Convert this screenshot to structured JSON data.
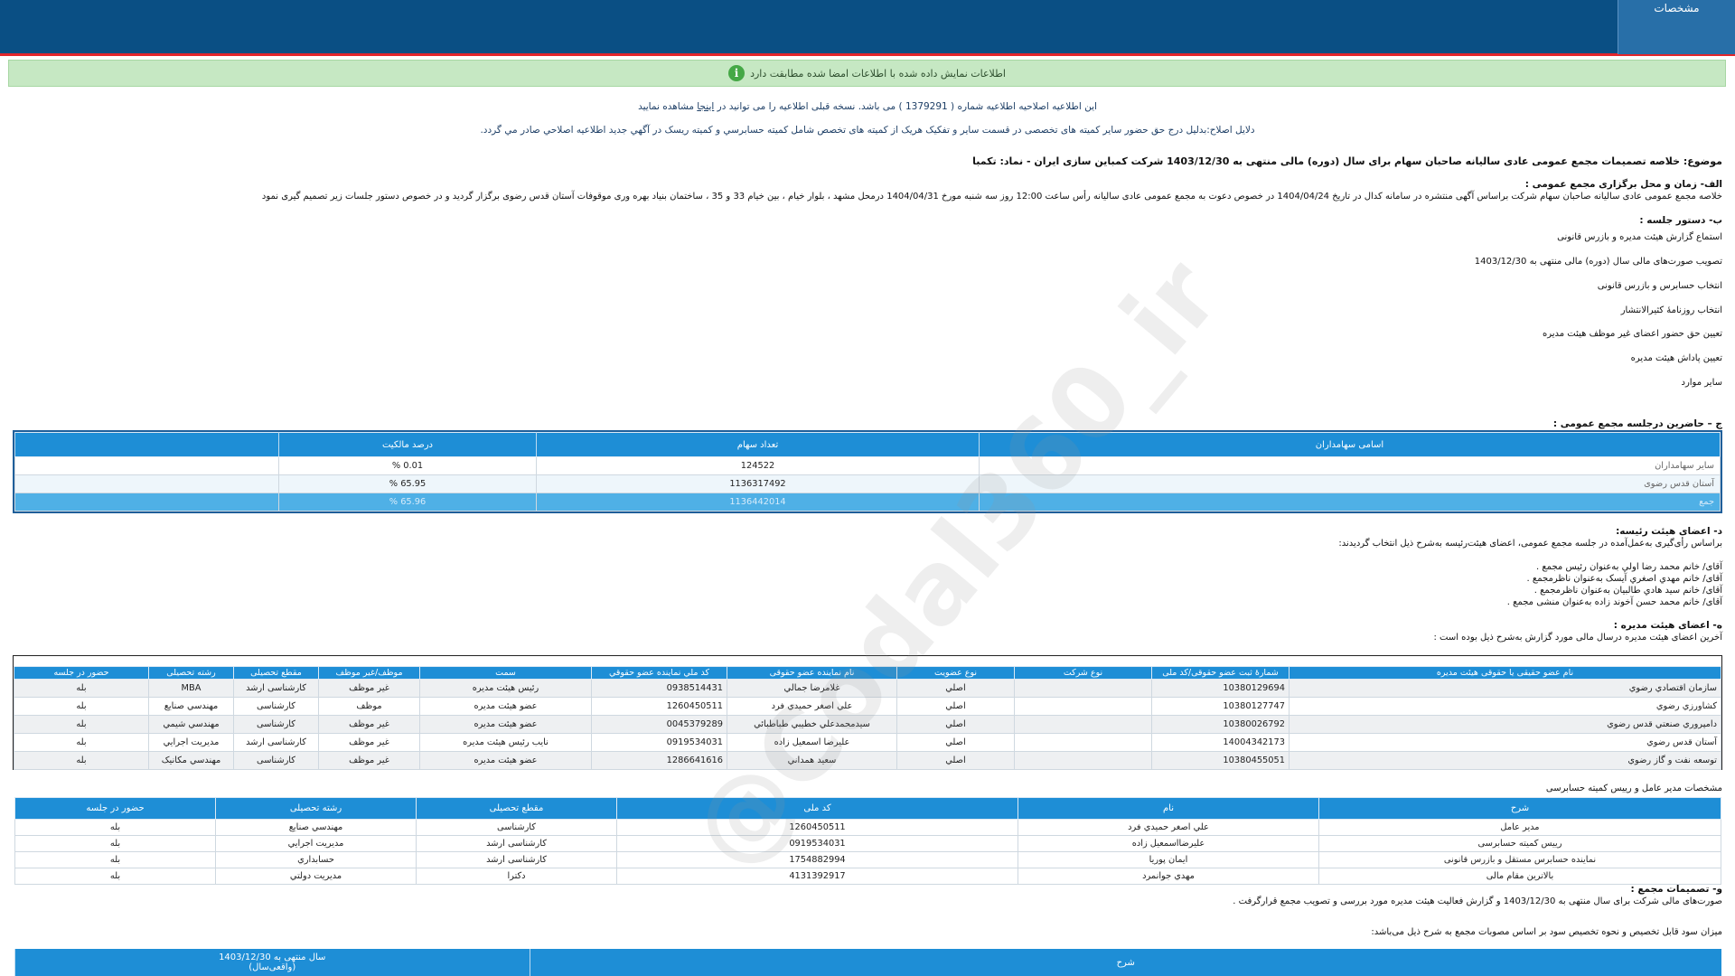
{
  "header": {
    "tab_label": "مشخصات"
  },
  "info_bar": {
    "text": "اطلاعات نمایش داده شده با اطلاعات امضا شده مطابقت دارد",
    "icon": "info-icon"
  },
  "correction_notice": {
    "line1_prefix": "این اطلاعیه اصلاحیه اطلاعیه شماره ( 1379291 ) می باشد. نسخه قبلی اطلاعیه را می توانید در",
    "link": "اینجا",
    "line1_suffix": "مشاهده نمایید",
    "reason": "دلایل اصلاح:بدلیل درج حق حضور سایر کمیته های تخصصی در قسمت سایر و تفکیک هریک از کمیته های تخصص شامل کمیته حسابرسي و کمیته ریسک در آگهي جدید اطلاعیه اصلاحي صادر مي گردد."
  },
  "subject": "موضوع: خلاصه تصمیمات مجمع عمومی عادی سالیانه صاحبان سهام برای سال (دوره) مالی منتهی به 1403/12/30 شرکت کمباین سازی ایران - نماد: تکمبا",
  "section_a": {
    "title": "الف- زمان و محل برگزاری مجمع عمومی :",
    "text": "خلاصه مجمع عمومی عادی سالیانه صاحبان سهام شرکت براساس آگهی منتشره در سامانه کدال در تاریخ 1404/04/24 در خصوص دعوت به مجمع عمومی عادی سالیانه رأس ساعت 12:00 روز سه شنبه مورخ 1404/04/31 درمحل  مشهد ، بلوار خیام ، بین خیام 33 و 35 ، ساختمان بنیاد بهره وری موقوفات آستان قدس رضوی   برگزار گردید و در خصوص دستور جلسات زیر تصمیم گیری نمود"
  },
  "section_b": {
    "title": "ب- دستور جلسه :",
    "items": [
      "استماع گزارش هیئت مدیره و بازرس قانونی",
      "تصویب صورت‌های مالی سال (دوره) مالی منتهی به 1403/12/30",
      "انتخاب حسابرس و بازرس قانونی",
      "انتخاب روزنامۀ کثیرالانتشار",
      "تعیین حق حضور اعضای غیر موظف هیئت مدیره",
      "تعیین پاداش هیئت مدیره",
      "سایر موارد"
    ]
  },
  "section_c": {
    "title": "ج – حاضرین درجلسه مجمع عمومی :",
    "headers": [
      "اسامی سهامداران",
      "تعداد سهام",
      "درصد مالکیت"
    ],
    "rows": [
      {
        "name": "سایر سهامداران",
        "shares": "124522",
        "percent": "0.01 %"
      },
      {
        "name": "آستان قدس رضوی",
        "shares": "1136317492",
        "percent": "65.95 %"
      }
    ],
    "total": {
      "name": "جمع",
      "shares": "1136442014",
      "percent": "65.96 %"
    }
  },
  "section_d": {
    "title": "د- اعضای هیئت رئیسه:",
    "intro": "براساس رأی‌گیری به‌عمل‌آمده در جلسه مجمع عمومی، اعضای هیئت‌رئیسه به‌شرح ذیل انتخاب گردیدند:",
    "members": [
      "آقای/ خانم  محمد رضا اولي  به‌عنوان رئیس مجمع .",
      "آقای/ خانم  مهدي اصغري آيسک  به‌عنوان ناظرمجمع .",
      "آقای/ خانم  سید هادي طالبيان  به‌عنوان ناظرمجمع .",
      "آقای/ خانم  محمد حسن آخوند زاده  به‌عنوان منشی مجمع ."
    ]
  },
  "section_e": {
    "title": "ه- اعضای هیئت مدیره :",
    "intro": "آخرین اعضای هیئت مدیره درسال مالی مورد گزارش به‌شرح ذیل بوده است :",
    "headers": [
      "نام عضو حقیقی یا حقوقی هیئت مدیره",
      "شمارۀ ثبت عضو حقوقی/کد ملی",
      "نوع شرکت",
      "نوع عضویت",
      "نام نماینده عضو حقوقی",
      "کد ملي نماینده عضو حقوقي",
      "سمت",
      "موظف/غیر موظف",
      "مقطع تحصیلی",
      "رشته تحصیلی",
      "حضور در جلسه"
    ],
    "rows": [
      [
        "سازمان اقتصادي رضوي",
        "10380129694",
        "",
        "اصلي",
        "غلامرضا جمالي",
        "0938514431",
        "رئیس هیئت مدیره",
        "غیر موظف",
        "کارشناسی ارشد",
        "MBA",
        "بله"
      ],
      [
        "کشاورزي رضوي",
        "10380127747",
        "",
        "اصلي",
        "علي اصغر حمیدي فرد",
        "1260450511",
        "عضو هیئت مدیره",
        "موظف",
        "کارشناسی",
        "مهندسي صنایع",
        "بله"
      ],
      [
        "دامپروري صنعتي قدس رضوي",
        "10380026792",
        "",
        "اصلي",
        "سیدمحمدعلي خطیبي طباطبائي",
        "0045379289",
        "عضو هیئت مدیره",
        "غیر موظف",
        "کارشناسی",
        "مهندسي شیمي",
        "بله"
      ],
      [
        "آستان قدس رضوي",
        "14004342173",
        "",
        "اصلي",
        "علیرضا اسمعیل زاده",
        "0919534031",
        "نایب رئیس هیئت مدیره",
        "غیر موظف",
        "کارشناسی ارشد",
        "مدیریت اجرایي",
        "بله"
      ],
      [
        "توسعه نفت و گاز رضوي",
        "10380455051",
        "",
        "اصلي",
        "سعید همداني",
        "1286641616",
        "عضو هیئت مدیره",
        "غیر موظف",
        "کارشناسی",
        "مهندسي مکانیک",
        "بله"
      ]
    ]
  },
  "ceo_section": {
    "title": "مشخصات مدیر عامل و رییس کمیته حسابرسی",
    "headers": [
      "شرح",
      "نام",
      "کد ملی",
      "مقطع تحصیلی",
      "رشته تحصیلی",
      "حضور در جلسه"
    ],
    "rows": [
      [
        "مدير عامل",
        "علي اصغر حمیدي فرد",
        "1260450511",
        "کارشناسی",
        "مهندسي صنایع",
        "بله"
      ],
      [
        "رییس کمیته حسابرسی",
        "علیرضااسمعیل زاده",
        "0919534031",
        "کارشناسی ارشد",
        "مدیریت اجرایي",
        "بله"
      ],
      [
        "نماینده حسابرس مستقل و بازرس قانونی",
        "ایمان پوریا",
        "1754882994",
        "کارشناسی ارشد",
        "حسابداري",
        "بله"
      ],
      [
        "بالاترین مقام مالی",
        "مهدي جوانمرد",
        "4131392917",
        "دکترا",
        "مدیریت دولتي",
        "بله"
      ]
    ]
  },
  "section_f": {
    "title": "و- تصمیمات مجمع :",
    "text": "صورت‌های مالی شرکت برای سال منتهی به  1403/12/30  و گزارش فعالیت هیئت مدیره مورد بررسی و تصویب مجمع قرارگرفت .",
    "profit_intro": "میزان سود قابل تخصیص و نحوه تخصیص سود بر اساس مصوبات مجمع به شرح ذیل می‌باشد:"
  },
  "bottom_table": {
    "headers": [
      "شرح",
      "سال منتهی به 1403/12/30",
      "(واقعی‌سال)"
    ]
  },
  "watermark": "@Codal360_ir"
}
